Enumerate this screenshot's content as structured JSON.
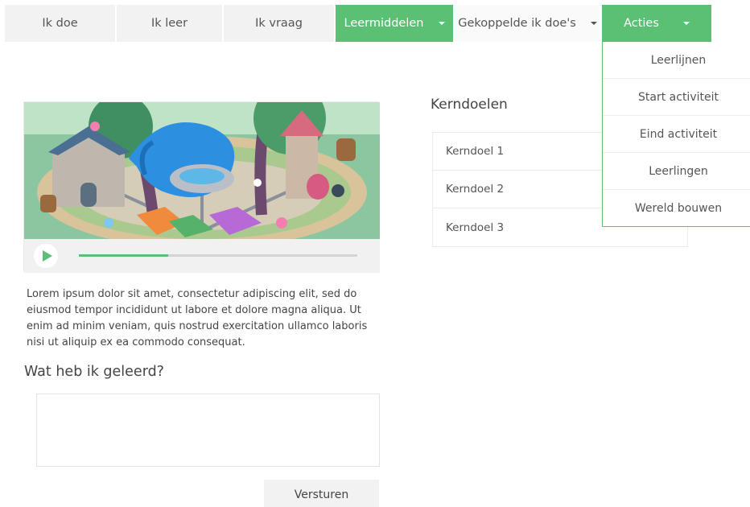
{
  "nav": {
    "tabs": [
      {
        "label": "Ik doe"
      },
      {
        "label": "Ik leer"
      },
      {
        "label": "Ik vraag"
      },
      {
        "label": "Leermiddelen"
      },
      {
        "label": "Gekoppelde ik doe's"
      },
      {
        "label": "Acties"
      }
    ]
  },
  "actions_menu": {
    "items": [
      {
        "label": "Leerlijnen"
      },
      {
        "label": "Start activiteit"
      },
      {
        "label": "Eind activiteit"
      },
      {
        "label": "Leerlingen"
      },
      {
        "label": "Wereld bouwen"
      }
    ]
  },
  "video": {
    "progress_percent": 32
  },
  "description": "Lorem ipsum dolor sit amet, consectetur adipiscing elit, sed do eiusmod tempor incididunt ut labore et dolore magna aliqua. Ut enim ad minim veniam, quis nostrud exercitation ullamco laboris nisi ut aliquip ex ea commodo consequat.",
  "learned": {
    "heading": "Wat heb ik geleerd?",
    "placeholder": "",
    "submit_label": "Versturen"
  },
  "kerndoelen": {
    "title": "Kerndoelen",
    "items": [
      {
        "label": "Kerndoel 1"
      },
      {
        "label": "Kerndoel 2"
      },
      {
        "label": "Kerndoel 3"
      }
    ]
  },
  "colors": {
    "accent": "#5bbf74",
    "tab_bg": "#f2f2f2"
  },
  "icons": [
    "play-icon",
    "caret-down-icon"
  ]
}
